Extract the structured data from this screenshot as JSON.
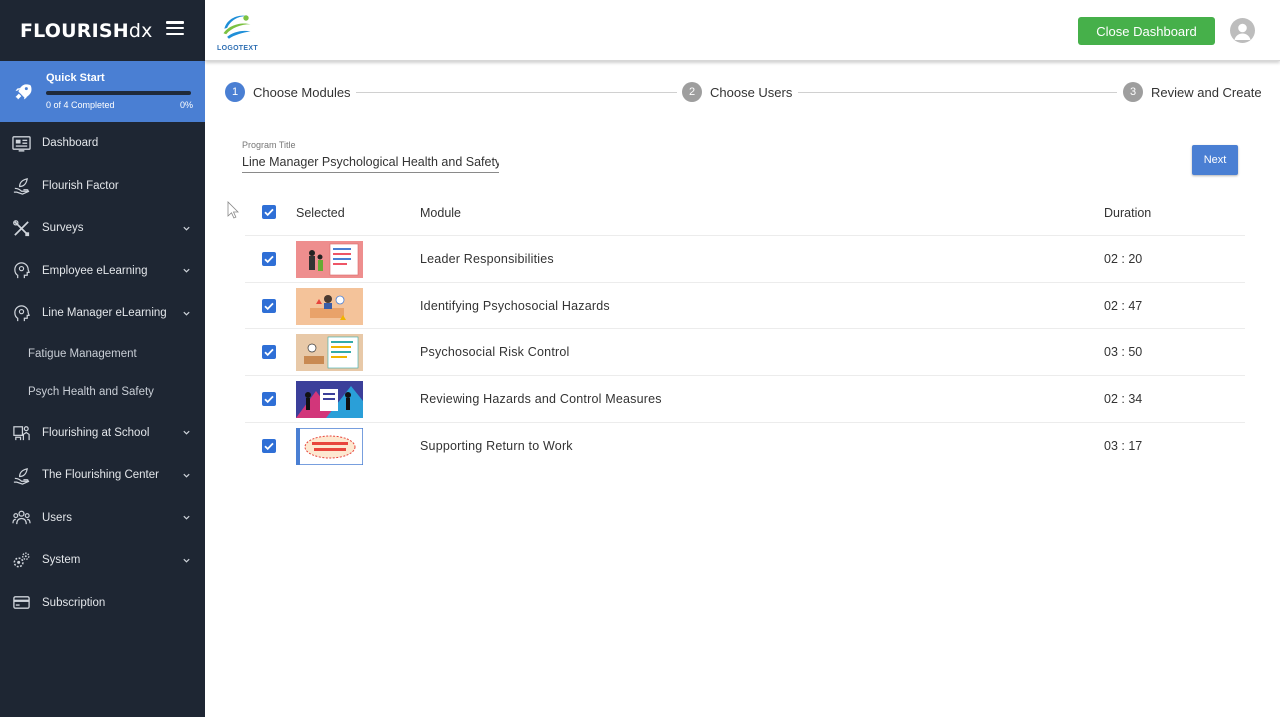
{
  "brand": {
    "bold": "FLOURISH",
    "light": "dx"
  },
  "quick_start": {
    "title": "Quick Start",
    "status": "0 of 4 Completed",
    "percent": "0%",
    "progress": 0
  },
  "nav": [
    {
      "label": "Dashboard",
      "icon": "dashboard-icon"
    },
    {
      "label": "Flourish Factor",
      "icon": "leaf-hand-icon"
    },
    {
      "label": "Surveys",
      "icon": "tools-icon",
      "chevron": true
    },
    {
      "label": "Employee eLearning",
      "icon": "head-icon",
      "chevron": true
    },
    {
      "label": "Line Manager eLearning",
      "icon": "head-icon",
      "chevron": true
    },
    {
      "label": "Fatigue Management",
      "sub": true
    },
    {
      "label": "Psych Health and Safety",
      "sub": true
    },
    {
      "label": "Flourishing at School",
      "icon": "school-icon",
      "chevron": true
    },
    {
      "label": "The Flourishing Center",
      "icon": "leaf-hand-icon",
      "chevron": true
    },
    {
      "label": "Users",
      "icon": "users-icon",
      "chevron": true
    },
    {
      "label": "System",
      "icon": "gears-icon",
      "chevron": true
    },
    {
      "label": "Subscription",
      "icon": "card-icon"
    }
  ],
  "header": {
    "logo_text": "LOGOTEXT",
    "close_label": "Close Dashboard"
  },
  "stepper": [
    {
      "num": "1",
      "label": "Choose Modules",
      "active": true
    },
    {
      "num": "2",
      "label": "Choose Users",
      "active": false
    },
    {
      "num": "3",
      "label": "Review and Create",
      "active": false
    }
  ],
  "program": {
    "label": "Program Title",
    "value": "Line Manager Psychological Health and Safety Program"
  },
  "next_label": "Next",
  "table": {
    "headers": {
      "selected": "Selected",
      "module": "Module",
      "duration": "Duration"
    },
    "rows": [
      {
        "module": "Leader Responsibilities",
        "duration": "02 : 20",
        "checked": true
      },
      {
        "module": "Identifying Psychosocial Hazards",
        "duration": "02 : 47",
        "checked": true
      },
      {
        "module": "Psychosocial Risk Control",
        "duration": "03 : 50",
        "checked": true
      },
      {
        "module": "Reviewing Hazards and Control Measures",
        "duration": "02 : 34",
        "checked": true
      },
      {
        "module": "Supporting Return to Work",
        "duration": "03 : 17",
        "checked": true
      }
    ]
  },
  "colors": {
    "sidebar": "#1e2633",
    "accent": "#4a7fd3",
    "success": "#46b04a",
    "checkbox": "#2f6fd6"
  }
}
